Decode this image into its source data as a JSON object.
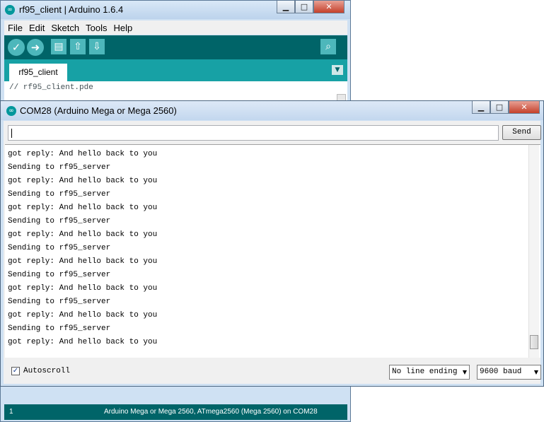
{
  "ide": {
    "title": "rf95_client | Arduino 1.6.4",
    "menu": [
      "File",
      "Edit",
      "Sketch",
      "Tools",
      "Help"
    ],
    "tab": "rf95_client",
    "code_line": "// rf95_client.pde",
    "status_line": "1",
    "status_board": "Arduino Mega or Mega 2560, ATmega2560 (Mega 2560) on COM28"
  },
  "serial": {
    "title": "COM28 (Arduino Mega or Mega 2560)",
    "send_label": "Send",
    "input_value": "",
    "output": [
      "got reply: And hello back to you",
      "Sending to rf95_server",
      "got reply: And hello back to you",
      "Sending to rf95_server",
      "got reply: And hello back to you",
      "Sending to rf95_server",
      "got reply: And hello back to you",
      "Sending to rf95_server",
      "got reply: And hello back to you",
      "Sending to rf95_server",
      "got reply: And hello back to you",
      "Sending to rf95_server",
      "got reply: And hello back to you",
      "Sending to rf95_server",
      "got reply: And hello back to you"
    ],
    "autoscroll_label": "Autoscroll",
    "autoscroll_checked": true,
    "line_ending": "No line ending",
    "baud": "9600 baud"
  },
  "icons": {
    "verify": "check-icon",
    "upload": "arrow-right-icon",
    "new": "new-file-icon",
    "open": "open-arrow-up-icon",
    "save": "save-arrow-down-icon",
    "serial_monitor": "magnifier-icon"
  },
  "colors": {
    "toolbar": "#006468",
    "tabbar": "#17a1a5",
    "button": "#4db7bb"
  }
}
